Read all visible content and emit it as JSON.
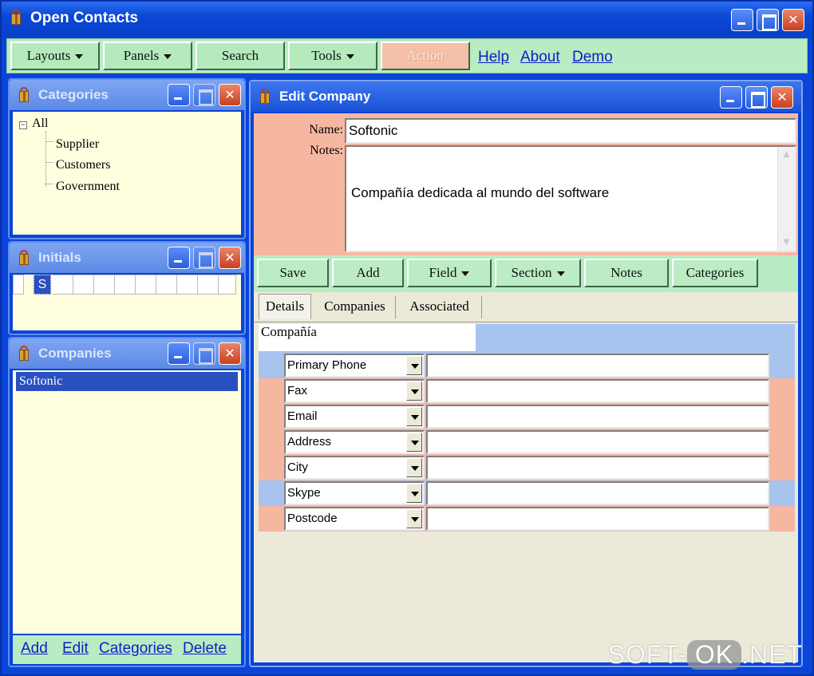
{
  "window": {
    "title": "Open Contacts"
  },
  "toolbar": {
    "layouts": "Layouts",
    "panels": "Panels",
    "search": "Search",
    "tools": "Tools",
    "action": "Action",
    "links": [
      "Help",
      "About",
      "Demo"
    ]
  },
  "categories_panel": {
    "title": "Categories",
    "root": "All",
    "children": [
      "Supplier",
      "Customers",
      "Government"
    ]
  },
  "initials_panel": {
    "title": "Initials",
    "selected": "S"
  },
  "companies_panel": {
    "title": "Companies",
    "items": [
      "Softonic"
    ],
    "links": [
      "Add",
      "Edit",
      "Categories",
      "Delete"
    ]
  },
  "edit_company": {
    "title": "Edit Company",
    "name_label": "Name:",
    "name_value": "Softonic",
    "notes_label": "Notes:",
    "notes_value": "Compañía dedicada al mundo del software",
    "buttons": [
      "Save",
      "Add",
      "Field",
      "Section",
      "Notes",
      "Categories"
    ],
    "tabs": [
      "Details",
      "Companies",
      "Associated"
    ],
    "section_name": "Compañía",
    "fields": [
      {
        "type": "Primary Phone",
        "value": "",
        "color": "#a7c4ee"
      },
      {
        "type": "Fax",
        "value": "",
        "color": "#f6b7a1"
      },
      {
        "type": "Email",
        "value": "",
        "color": "#f6b7a1"
      },
      {
        "type": "Address",
        "value": "",
        "color": "#f6b7a1"
      },
      {
        "type": "City",
        "value": "",
        "color": "#f6b7a1"
      },
      {
        "type": "Skype",
        "value": "",
        "color": "#a7c4ee"
      },
      {
        "type": "Postcode",
        "value": "",
        "color": "#f6b7a1"
      }
    ]
  },
  "watermark": {
    "left": "SOFT-",
    "mid": "OK",
    "right": ".NET"
  },
  "colors": {
    "titlebar": "#0a44d8",
    "toolbar_green": "#b9ecc3",
    "panel_yellow": "#ffffe0",
    "edit_salmon": "#f6b7a1",
    "edit_blue": "#a7c4ee",
    "link": "#0c20c8"
  }
}
